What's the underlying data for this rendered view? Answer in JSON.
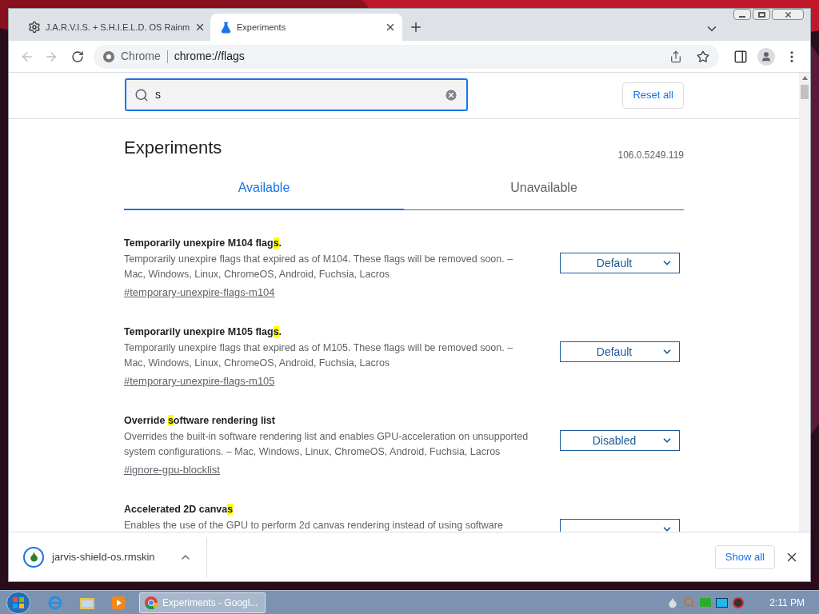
{
  "tabs": [
    {
      "title": "J.A.R.V.I.S. + S.H.I.E.L.D. OS Rainm",
      "selected": false
    },
    {
      "title": "Experiments",
      "selected": true
    }
  ],
  "omnibox": {
    "site": "Chrome",
    "url": "chrome://flags"
  },
  "search": {
    "value": "s"
  },
  "reset_button": "Reset all",
  "page": {
    "title": "Experiments",
    "version": "106.0.5249.119",
    "tabs": [
      {
        "label": "Available",
        "selected": true
      },
      {
        "label": "Unavailable",
        "selected": false
      }
    ],
    "flags": [
      {
        "title_start": "Temporarily unexpire M104 flag",
        "title_match": "s",
        "title_end": ".",
        "description": "Temporarily unexpire flags that expired as of M104. These flags will be removed soon. – Mac, Windows, Linux, ChromeOS, Android, Fuchsia, Lacros",
        "link": "#temporary-unexpire-flags-m104",
        "value": "Default"
      },
      {
        "title_start": "Temporarily unexpire M105 flag",
        "title_match": "s",
        "title_end": ".",
        "description": "Temporarily unexpire flags that expired as of M105. These flags will be removed soon. – Mac, Windows, Linux, ChromeOS, Android, Fuchsia, Lacros",
        "link": "#temporary-unexpire-flags-m105",
        "value": "Default"
      },
      {
        "title_start": "Override ",
        "title_match": "s",
        "title_end": "oftware rendering list",
        "description": "Overrides the built-in software rendering list and enables GPU-acceleration on unsupported system configurations. – Mac, Windows, Linux, ChromeOS, Android, Fuchsia, Lacros",
        "link": "#ignore-gpu-blocklist",
        "value": "Disabled"
      },
      {
        "title_start": "Accelerated 2D canva",
        "title_match": "s",
        "description": "Enables the use of the GPU to perform 2d canvas rendering instead of using software"
      }
    ]
  },
  "download": {
    "filename": "jarvis-shield-os.rmskin",
    "show_all": "Show all"
  },
  "taskbar": {
    "task": "Experiments - Googl...",
    "time": "2:11 PM"
  }
}
